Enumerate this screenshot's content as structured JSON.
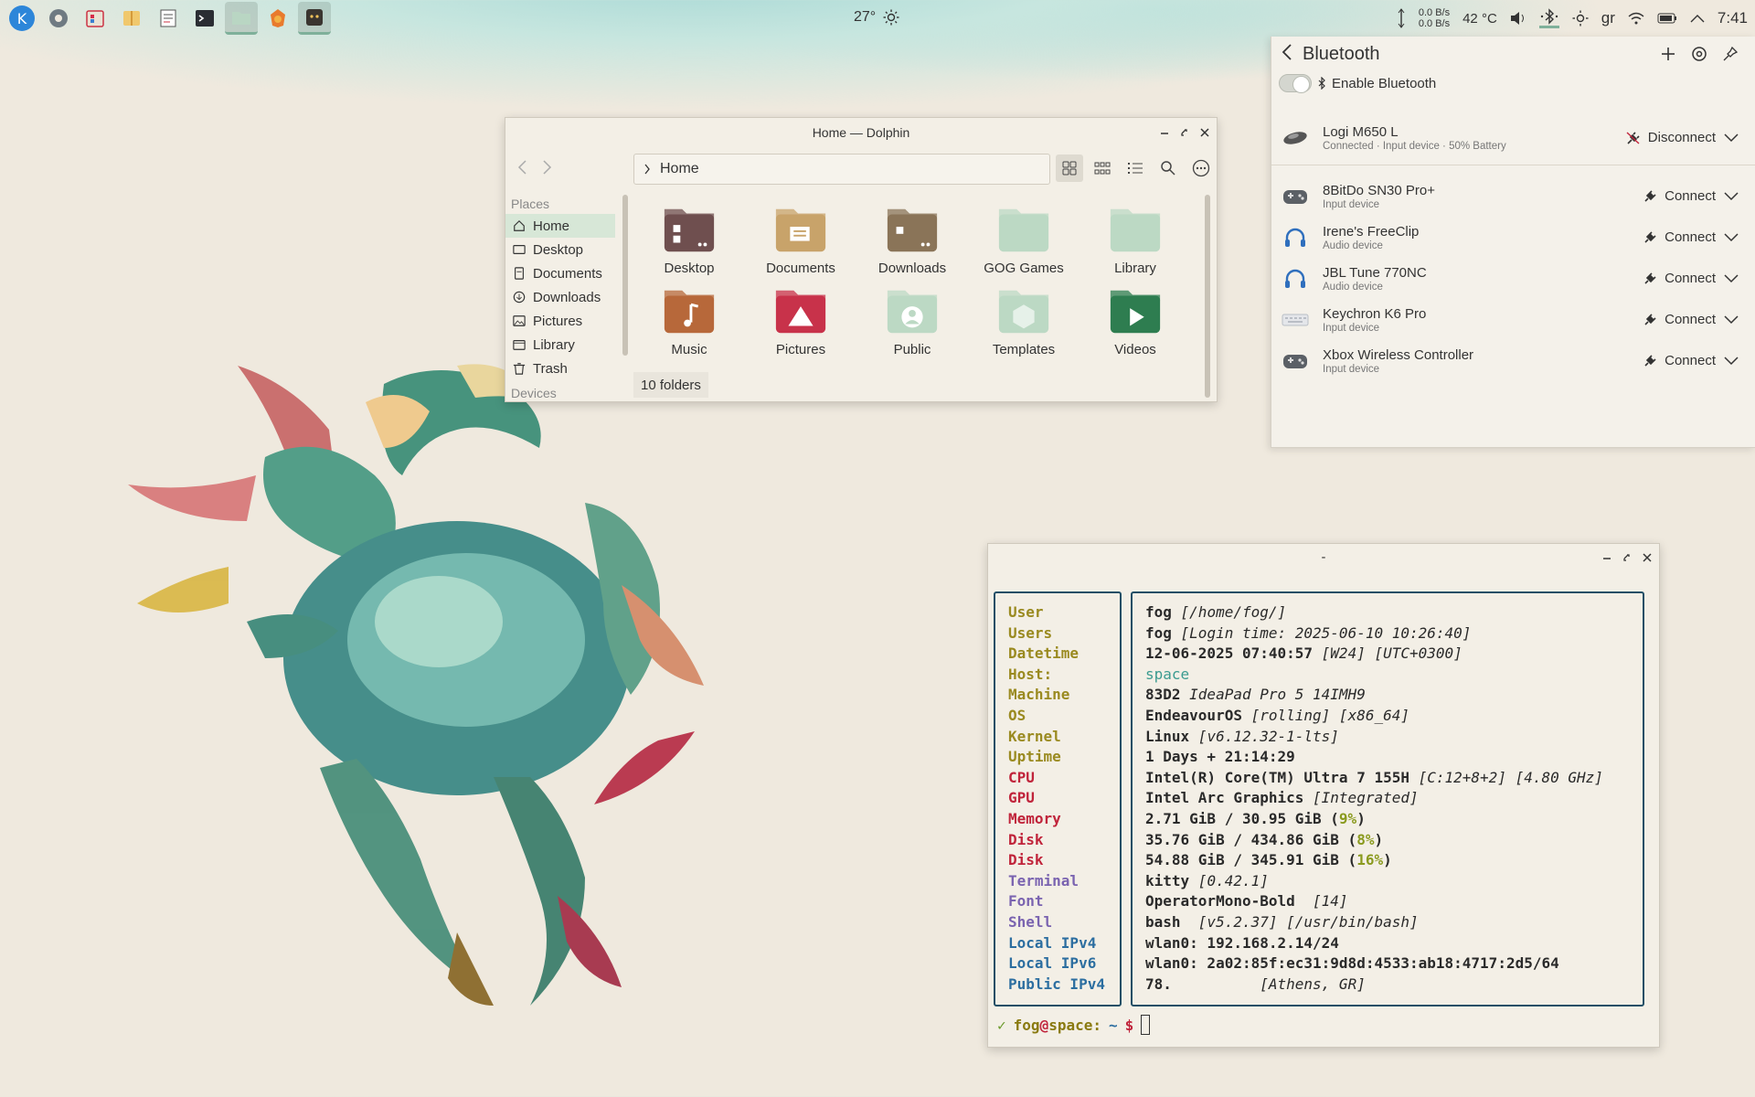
{
  "panel": {
    "weather": "27°",
    "net_up": "0.0 B/s",
    "net_down": "0.0 B/s",
    "cpu_temp": "42 °C",
    "layout": "gr",
    "clock": "7:41"
  },
  "bluetooth": {
    "title": "Bluetooth",
    "enable_label": "Enable Bluetooth",
    "devices": [
      {
        "name": "Logi M650 L",
        "sub": "Connected · Input device · 50% Battery",
        "action": "Disconnect",
        "icon": "mouse-icon"
      },
      {
        "name": "8BitDo SN30 Pro+",
        "sub": "Input device",
        "action": "Connect",
        "icon": "gamepad-icon"
      },
      {
        "name": "Irene's FreeClip",
        "sub": "Audio device",
        "action": "Connect",
        "icon": "headphones-icon"
      },
      {
        "name": "JBL Tune 770NC",
        "sub": "Audio device",
        "action": "Connect",
        "icon": "headphones-icon"
      },
      {
        "name": "Keychron K6 Pro",
        "sub": "Input device",
        "action": "Connect",
        "icon": "keyboard-icon"
      },
      {
        "name": "Xbox Wireless Controller",
        "sub": "Input device",
        "action": "Connect",
        "icon": "gamepad-icon"
      }
    ]
  },
  "dolphin": {
    "title": "Home — Dolphin",
    "path": "Home",
    "places_header": "Places",
    "places": [
      "Home",
      "Desktop",
      "Documents",
      "Downloads",
      "Pictures",
      "Library",
      "Trash"
    ],
    "devices_header": "Devices",
    "files": [
      {
        "name": "Desktop",
        "color": "#6f4f4f"
      },
      {
        "name": "Documents",
        "color": "#c8a36a"
      },
      {
        "name": "Downloads",
        "color": "#8a7458"
      },
      {
        "name": "GOG Games",
        "color": "#bcd9c4"
      },
      {
        "name": "Library",
        "color": "#bcd9c4"
      },
      {
        "name": "Music",
        "color": "#b7683a"
      },
      {
        "name": "Pictures",
        "color": "#c8324a"
      },
      {
        "name": "Public",
        "color": "#bcd9c4"
      },
      {
        "name": "Templates",
        "color": "#bcd9c4"
      },
      {
        "name": "Videos",
        "color": "#2e7d50"
      }
    ],
    "status": "10 folders"
  },
  "terminal": {
    "title": "-",
    "rows": [
      {
        "key": "User",
        "val": "fog",
        "extra": " [/home/fog/]"
      },
      {
        "key": "Users",
        "val": "fog",
        "extra": " [Login time: 2025-06-10 10:26:40]"
      },
      {
        "key": "Datetime",
        "val": "12-06-2025 07:40:57",
        "extra": " [W24] [UTC+0300]"
      },
      {
        "key": "Host:",
        "val": "space",
        "extra": ""
      },
      {
        "key": "Machine",
        "val": "83D2",
        "extra": " IdeaPad Pro 5 14IMH9"
      },
      {
        "key": "OS",
        "val": "EndeavourOS",
        "extra": " [rolling] [x86_64]"
      },
      {
        "key": "Kernel",
        "val": "Linux",
        "extra": " [v6.12.32-1-lts]"
      },
      {
        "key": "Uptime",
        "val": "1 Days + 21:14:29",
        "extra": ""
      },
      {
        "key": "CPU",
        "val": "Intel(R) Core(TM) Ultra 7 155H",
        "extra": " [C:12+8+2] [4.80 GHz]"
      },
      {
        "key": "GPU",
        "val": "Intel Arc Graphics",
        "extra": " [Integrated]"
      },
      {
        "key": "Memory",
        "val": "2.71 GiB / 30.95 GiB (",
        "pct": "9%",
        "tail": ")"
      },
      {
        "key": "Disk",
        "val": "35.76 GiB / 434.86 GiB (",
        "pct": "8%",
        "tail": ")"
      },
      {
        "key": "Disk",
        "val": "54.88 GiB / 345.91 GiB (",
        "pct": "16%",
        "tail": ")"
      },
      {
        "key": "Terminal",
        "val": "kitty",
        "extra": " [0.42.1]"
      },
      {
        "key": "Font",
        "val": "OperatorMono-Bold ",
        "extra": " [14]"
      },
      {
        "key": "Shell",
        "val": "bash",
        "extra": "  [v5.2.37] [/usr/bin/bash]"
      },
      {
        "key": "Local IPv4",
        "val": "wlan0: 192.168.2.14/24",
        "extra": ""
      },
      {
        "key": "Local IPv6",
        "val": "wlan0: 2a02:85f:ec31:9d8d:4533:ab18:4717:2d5/64",
        "extra": ""
      },
      {
        "key": "Public IPv4",
        "val": "78.",
        "extra": "          [Athens, GR]"
      }
    ],
    "prompt": {
      "check": "✓",
      "user": "fog",
      "at": "@",
      "host": "space",
      "colon": ":",
      "tilde": "~",
      "dollar": "$"
    }
  },
  "colors": {
    "accent": "#7fb09a",
    "term_border": "#1f4f66",
    "term_red": "#c0243b",
    "term_yellow": "#9a8a20",
    "term_blue": "#2c6ea0",
    "term_purple": "#7a63b0"
  }
}
